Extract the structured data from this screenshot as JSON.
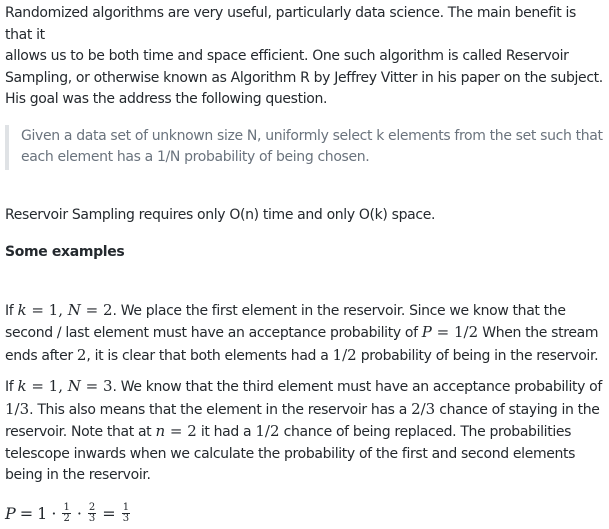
{
  "intro": {
    "l1": "Randomized algorithms are very useful, particularly data science. The main benefit is that it",
    "l2": "allows us to be both time and space efficient. One such algorithm is called Reservoir",
    "l3": "Sampling, or otherwise known as Algorithm R by Jeffrey Vitter in his paper on the subject.",
    "l4": "His goal was the address the following question."
  },
  "quote": {
    "l1": "Given a data set of unknown size N, uniformly select k elements from the set such that",
    "l2": "each element has a 1/N probability of being chosen."
  },
  "complexity": "Reservoir Sampling requires only O(n) time and only O(k) space.",
  "heading": "Some examples",
  "ex1": {
    "a_if": "If ",
    "a_math1": "k",
    "a_eq": " = 1, ",
    "a_math2": "N",
    "a_eq2": " = 2",
    "a_rest": ". We place the first element in the reservoir. Since we know that the",
    "b_start": "second / last element must have an acceptance probability of ",
    "b_P": "P",
    "b_val": " = 1/2",
    "b_rest": " When the stream",
    "c_start": "ends after ",
    "c_two": "2",
    "c_mid": ", it is clear that both elements had a ",
    "c_half": "1/2",
    "c_rest": " probability of being in the reservoir."
  },
  "ex2": {
    "a_if": "If ",
    "a_math1": "k",
    "a_eq": " = 1, ",
    "a_math2": "N",
    "a_eq2": " = 3",
    "a_rest": ". We know that the third element must have an acceptance probability of",
    "b_third": "1/3",
    "b_mid": ". This also means that the element in the reservoir has a ",
    "b_twothirds": "2/3",
    "b_rest": " chance of staying in the",
    "c_start": "reservoir. Note that at ",
    "c_n": "n",
    "c_eq": " = 2",
    "c_mid": " it had a ",
    "c_half": "1/2",
    "c_rest": " chance of being replaced. The probabilities",
    "d": "telescope inwards when we calculate the probability of the first and second elements",
    "e": "being in the reservoir."
  },
  "formula": {
    "P": "P",
    "eq1": "=",
    "one": "1",
    "dot1": "·",
    "f1_num": "1",
    "f1_den": "2",
    "dot2": "·",
    "f2_num": "2",
    "f2_den": "3",
    "eq2": "=",
    "f3_num": "1",
    "f3_den": "3"
  }
}
